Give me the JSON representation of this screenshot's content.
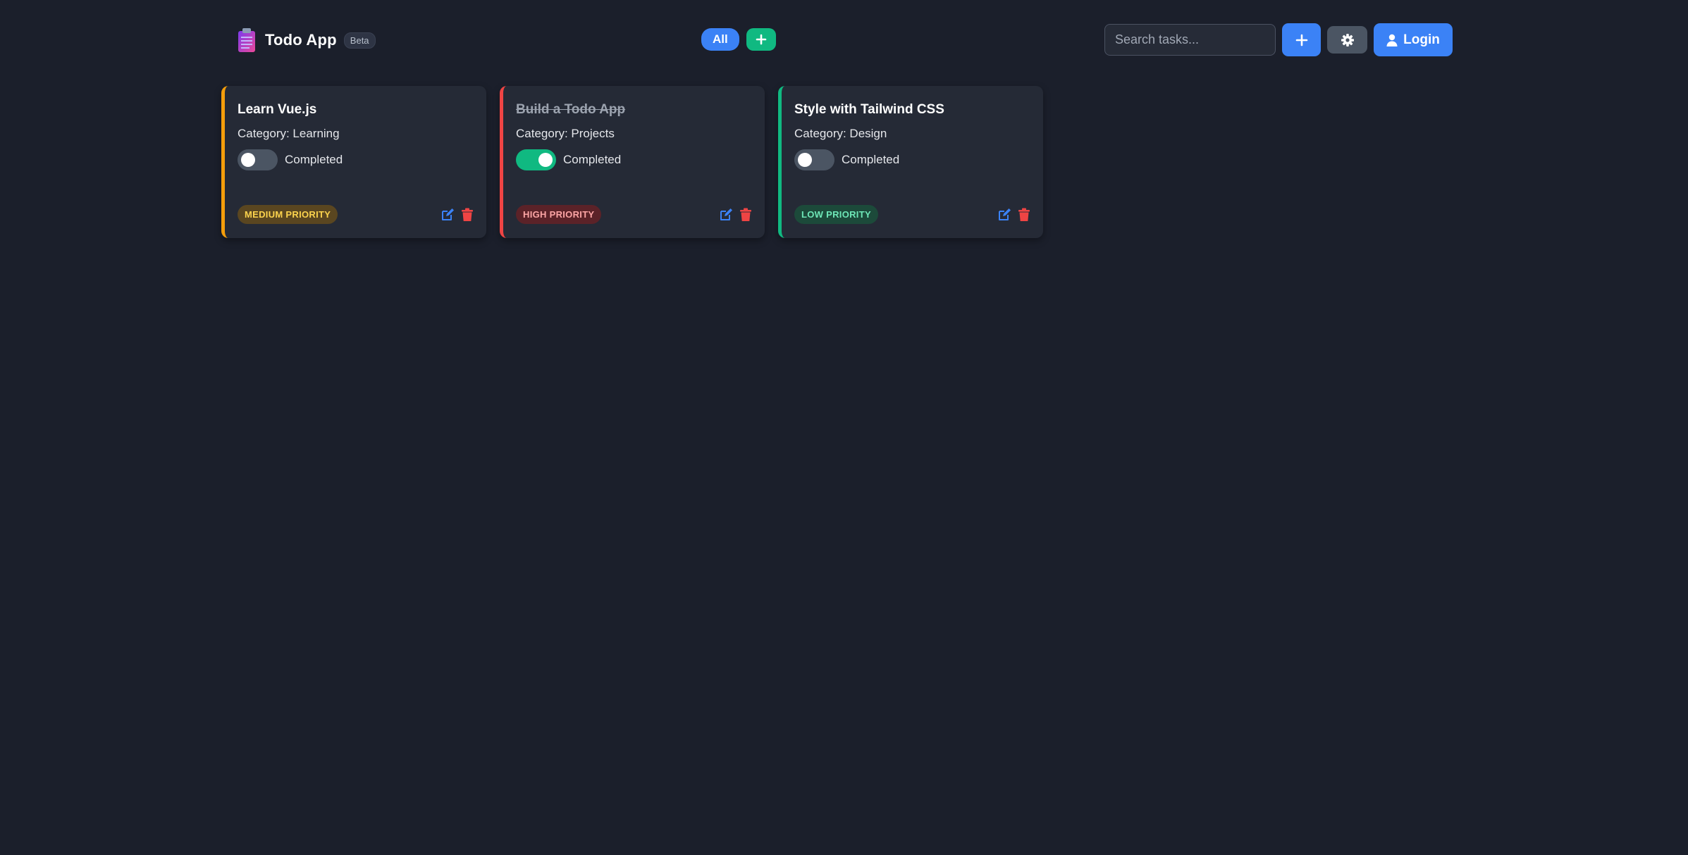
{
  "header": {
    "brand_title": "Todo App",
    "beta_label": "Beta",
    "filter_all_label": "All",
    "search_placeholder": "Search tasks...",
    "login_label": "Login"
  },
  "icons": {
    "brand": "clipboard-icon",
    "filter_add": "plus-icon",
    "add": "plus-icon",
    "settings": "gear-icon",
    "login": "user-icon",
    "edit": "edit-icon",
    "delete": "trash-icon"
  },
  "colors": {
    "background": "#1b1f2b",
    "card": "#252a36",
    "primary": "#3b82f6",
    "success": "#10b981",
    "medium": "#f59e0b",
    "high": "#ef4444",
    "low": "#10b981"
  },
  "tasks": [
    {
      "title": "Learn Vue.js",
      "category": "Category: Learning",
      "completed_label": "Completed",
      "completed": false,
      "priority_label": "MEDIUM PRIORITY"
    },
    {
      "title": "Build a Todo App",
      "category": "Category: Projects",
      "completed_label": "Completed",
      "completed": true,
      "priority_label": "HIGH PRIORITY"
    },
    {
      "title": "Style with Tailwind CSS",
      "category": "Category: Design",
      "completed_label": "Completed",
      "completed": false,
      "priority_label": "LOW PRIORITY"
    }
  ]
}
